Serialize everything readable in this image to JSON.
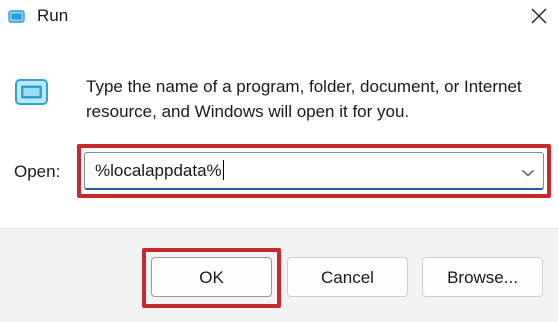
{
  "window": {
    "title": "Run",
    "app_icon": "run-icon",
    "close_icon": "close-icon"
  },
  "body": {
    "icon": "run-icon",
    "description": "Type the name of a program, folder, document, or Internet resource, and Windows will open it for you."
  },
  "open_field": {
    "label": "Open:",
    "value": "%localappdata%",
    "dropdown_icon": "chevron-down-icon"
  },
  "buttons": {
    "ok_label": "OK",
    "cancel_label": "Cancel",
    "browse_label": "Browse..."
  },
  "colors": {
    "highlight": "#c8282e",
    "focus_underline": "#1f5aa6",
    "footer_bg": "#f3f3f3"
  }
}
